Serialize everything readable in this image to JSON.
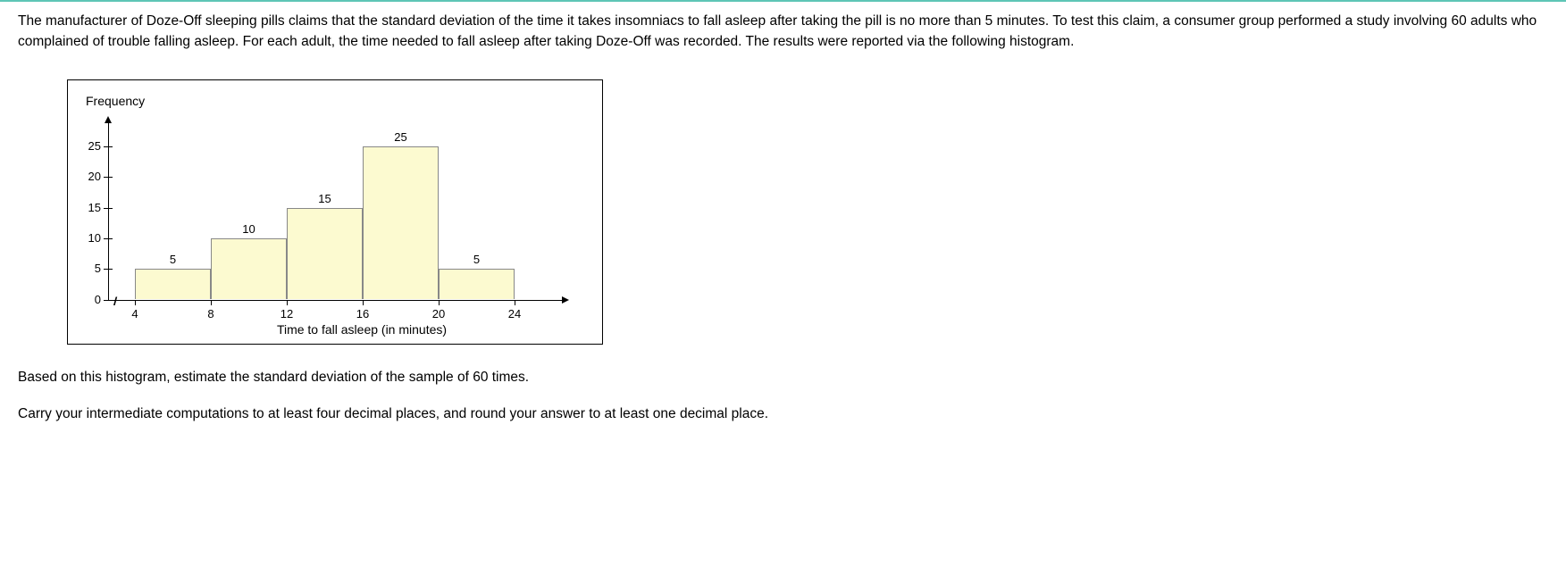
{
  "problem_text": "The manufacturer of Doze-Off sleeping pills claims that the standard deviation of the time it takes insomniacs to fall asleep after taking the pill is no more than 5 minutes. To test this claim, a consumer group performed a study involving 60 adults who complained of trouble falling asleep. For each adult, the time needed to fall asleep after taking Doze-Off was recorded. The results were reported via the following histogram.",
  "chart_data": {
    "type": "bar",
    "title": "",
    "ylabel": "Frequency",
    "xlabel": "Time to fall asleep (in minutes)",
    "y_ticks": [
      0,
      5,
      10,
      15,
      20,
      25
    ],
    "x_ticks": [
      4,
      8,
      12,
      16,
      20,
      24
    ],
    "ylim": [
      0,
      27
    ],
    "bins": [
      {
        "start": 4,
        "end": 8,
        "frequency": 5
      },
      {
        "start": 8,
        "end": 12,
        "frequency": 10
      },
      {
        "start": 12,
        "end": 16,
        "frequency": 15
      },
      {
        "start": 16,
        "end": 20,
        "frequency": 25
      },
      {
        "start": 20,
        "end": 24,
        "frequency": 5
      }
    ]
  },
  "question_text": "Based on this histogram, estimate the standard deviation of the sample of 60 times.",
  "instruction_text": "Carry your intermediate computations to at least four decimal places, and round your answer to at least one decimal place."
}
